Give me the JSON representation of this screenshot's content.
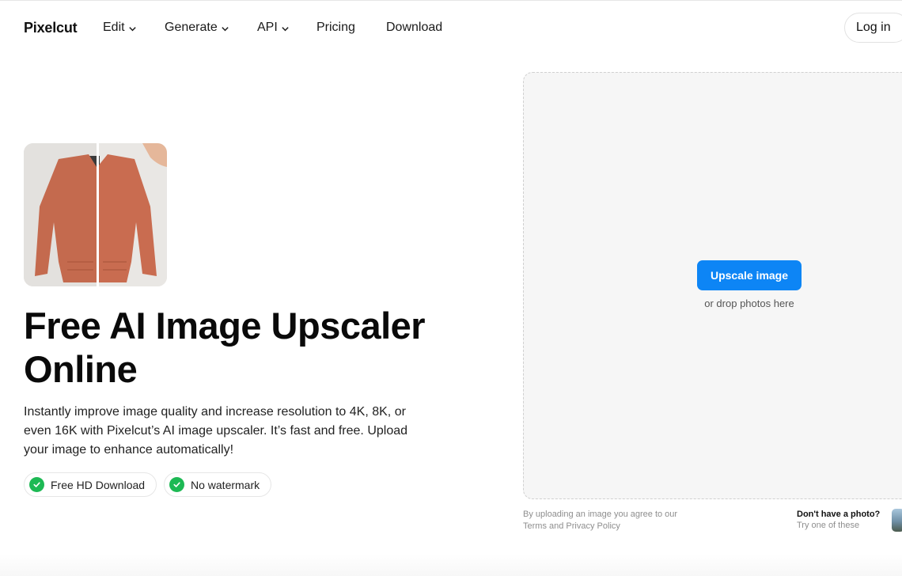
{
  "nav": {
    "logo": "Pixelcut",
    "items": [
      {
        "label": "Edit",
        "dropdown": true
      },
      {
        "label": "Generate",
        "dropdown": true
      },
      {
        "label": "API",
        "dropdown": true
      },
      {
        "label": "Pricing",
        "dropdown": false
      },
      {
        "label": "Download",
        "dropdown": false
      }
    ],
    "login_label": "Log in"
  },
  "hero": {
    "image_alt": "Before and after upscaled jacket photo",
    "headline_line1": "Free AI Image Upscaler",
    "headline_line2": "Online",
    "description": "Instantly improve image quality and increase resolution to 4K, 8K, or even 16K with Pixelcut’s AI image upscaler. It’s fast and free. Upload your image to enhance automatically!",
    "badges": [
      {
        "label": "Free HD Download",
        "icon": "check-icon"
      },
      {
        "label": "No watermark",
        "icon": "check-icon"
      }
    ]
  },
  "upload": {
    "button_label": "Upscale image",
    "drop_hint": "or drop photos here",
    "legal_prefix": "By uploading an image you agree to our ",
    "terms_label": "Terms",
    "and_label": " and ",
    "privacy_label": "Privacy Policy",
    "no_photo_title": "Don't have a photo?",
    "no_photo_sub": "Try one of these"
  },
  "colors": {
    "accent": "#0d85f5",
    "check": "#1db954",
    "dropzone_bg": "#f6f6f6"
  }
}
